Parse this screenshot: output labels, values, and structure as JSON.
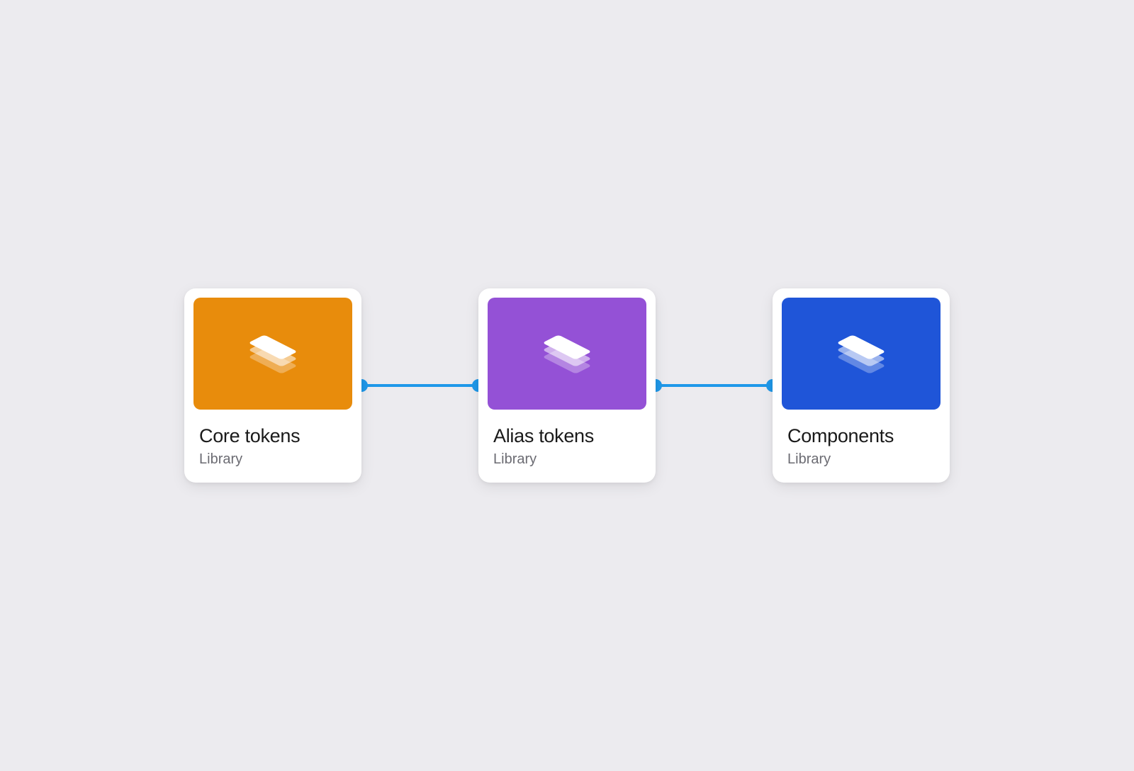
{
  "cards": [
    {
      "title": "Core tokens",
      "subtitle": "Library",
      "color": "#e88c0c"
    },
    {
      "title": "Alias tokens",
      "subtitle": "Library",
      "color": "#9451d6"
    },
    {
      "title": "Components",
      "subtitle": "Library",
      "color": "#1f55d8"
    }
  ],
  "connector_color": "#1f98e9"
}
